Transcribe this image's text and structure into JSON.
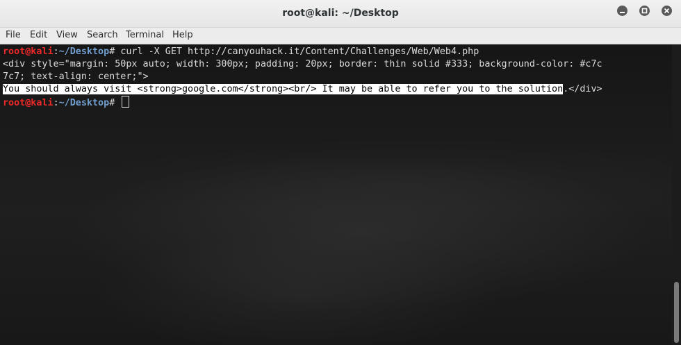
{
  "window": {
    "title": "root@kali: ~/Desktop"
  },
  "menu": {
    "file": "File",
    "edit": "Edit",
    "view": "View",
    "search": "Search",
    "terminal": "Terminal",
    "help": "Help"
  },
  "terminal": {
    "prompt_user": "root@kali",
    "prompt_sep": ":",
    "prompt_path": "~/Desktop",
    "prompt_symbol": "# ",
    "command": "curl -X GET http://canyouhack.it/Content/Challenges/Web/Web4.php",
    "output_line1": "<div style=\"margin: 50px auto; width: 300px; padding: 20px; border: thin solid #333; background-color: #c7c",
    "output_line2": "7c7; text-align: center;\">",
    "output_line3_selected": "You should always visit <strong>google.com</strong><br/> It may be able to refer you to the solution",
    "output_line3_rest": ".</div>"
  },
  "colors": {
    "prompt_user": "#ef2929",
    "prompt_path": "#729fcf",
    "terminal_text": "#dcdcdc"
  },
  "icons": {
    "minimize": "minimize-icon",
    "maximize": "maximize-icon",
    "close": "close-icon"
  }
}
